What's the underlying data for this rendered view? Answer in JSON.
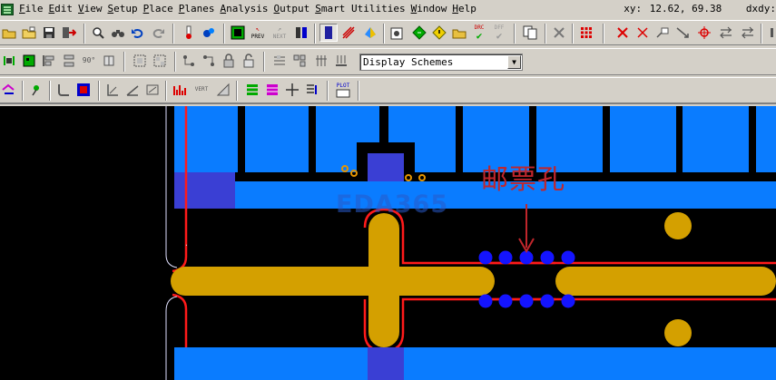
{
  "menu": {
    "items": [
      "File",
      "Edit",
      "View",
      "Setup",
      "Place",
      "Planes",
      "Analysis",
      "Output",
      "Smart Utilities",
      "Window",
      "Help"
    ]
  },
  "status": {
    "xy_label": "xy:",
    "xy_value": "12.62, 69.38",
    "dxdy_label": "dxdy:"
  },
  "toolbar2": {
    "display_schemes_value": "Display Schemes"
  },
  "toolbar1": {
    "prev_label": "PREV",
    "next_label": "NEXT",
    "drc_label": "DRC",
    "dff_label": "DFF"
  },
  "toolbar3": {
    "plot_label": "PLOT"
  },
  "canvas": {
    "annotation_text": "邮票孔",
    "watermark_text": "EDA365",
    "colors": {
      "background": "#000000",
      "copper_blue": "#0a7cff",
      "pad_dark_blue": "#3a3fd4",
      "trace_gold": "#d4a000",
      "outline_red": "#ff1a1a",
      "via_blue": "#1414ff"
    }
  }
}
